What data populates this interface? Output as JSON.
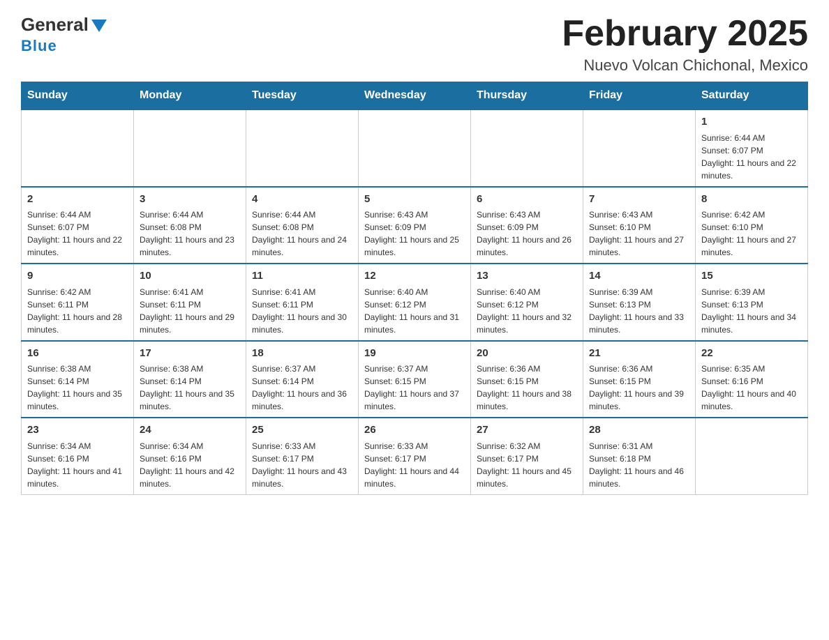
{
  "header": {
    "title": "February 2025",
    "subtitle": "Nuevo Volcan Chichonal, Mexico",
    "logo_general": "General",
    "logo_blue": "Blue"
  },
  "weekdays": [
    "Sunday",
    "Monday",
    "Tuesday",
    "Wednesday",
    "Thursday",
    "Friday",
    "Saturday"
  ],
  "weeks": [
    [
      {
        "day": "",
        "sunrise": "",
        "sunset": "",
        "daylight": ""
      },
      {
        "day": "",
        "sunrise": "",
        "sunset": "",
        "daylight": ""
      },
      {
        "day": "",
        "sunrise": "",
        "sunset": "",
        "daylight": ""
      },
      {
        "day": "",
        "sunrise": "",
        "sunset": "",
        "daylight": ""
      },
      {
        "day": "",
        "sunrise": "",
        "sunset": "",
        "daylight": ""
      },
      {
        "day": "",
        "sunrise": "",
        "sunset": "",
        "daylight": ""
      },
      {
        "day": "1",
        "sunrise": "Sunrise: 6:44 AM",
        "sunset": "Sunset: 6:07 PM",
        "daylight": "Daylight: 11 hours and 22 minutes."
      }
    ],
    [
      {
        "day": "2",
        "sunrise": "Sunrise: 6:44 AM",
        "sunset": "Sunset: 6:07 PM",
        "daylight": "Daylight: 11 hours and 22 minutes."
      },
      {
        "day": "3",
        "sunrise": "Sunrise: 6:44 AM",
        "sunset": "Sunset: 6:08 PM",
        "daylight": "Daylight: 11 hours and 23 minutes."
      },
      {
        "day": "4",
        "sunrise": "Sunrise: 6:44 AM",
        "sunset": "Sunset: 6:08 PM",
        "daylight": "Daylight: 11 hours and 24 minutes."
      },
      {
        "day": "5",
        "sunrise": "Sunrise: 6:43 AM",
        "sunset": "Sunset: 6:09 PM",
        "daylight": "Daylight: 11 hours and 25 minutes."
      },
      {
        "day": "6",
        "sunrise": "Sunrise: 6:43 AM",
        "sunset": "Sunset: 6:09 PM",
        "daylight": "Daylight: 11 hours and 26 minutes."
      },
      {
        "day": "7",
        "sunrise": "Sunrise: 6:43 AM",
        "sunset": "Sunset: 6:10 PM",
        "daylight": "Daylight: 11 hours and 27 minutes."
      },
      {
        "day": "8",
        "sunrise": "Sunrise: 6:42 AM",
        "sunset": "Sunset: 6:10 PM",
        "daylight": "Daylight: 11 hours and 27 minutes."
      }
    ],
    [
      {
        "day": "9",
        "sunrise": "Sunrise: 6:42 AM",
        "sunset": "Sunset: 6:11 PM",
        "daylight": "Daylight: 11 hours and 28 minutes."
      },
      {
        "day": "10",
        "sunrise": "Sunrise: 6:41 AM",
        "sunset": "Sunset: 6:11 PM",
        "daylight": "Daylight: 11 hours and 29 minutes."
      },
      {
        "day": "11",
        "sunrise": "Sunrise: 6:41 AM",
        "sunset": "Sunset: 6:11 PM",
        "daylight": "Daylight: 11 hours and 30 minutes."
      },
      {
        "day": "12",
        "sunrise": "Sunrise: 6:40 AM",
        "sunset": "Sunset: 6:12 PM",
        "daylight": "Daylight: 11 hours and 31 minutes."
      },
      {
        "day": "13",
        "sunrise": "Sunrise: 6:40 AM",
        "sunset": "Sunset: 6:12 PM",
        "daylight": "Daylight: 11 hours and 32 minutes."
      },
      {
        "day": "14",
        "sunrise": "Sunrise: 6:39 AM",
        "sunset": "Sunset: 6:13 PM",
        "daylight": "Daylight: 11 hours and 33 minutes."
      },
      {
        "day": "15",
        "sunrise": "Sunrise: 6:39 AM",
        "sunset": "Sunset: 6:13 PM",
        "daylight": "Daylight: 11 hours and 34 minutes."
      }
    ],
    [
      {
        "day": "16",
        "sunrise": "Sunrise: 6:38 AM",
        "sunset": "Sunset: 6:14 PM",
        "daylight": "Daylight: 11 hours and 35 minutes."
      },
      {
        "day": "17",
        "sunrise": "Sunrise: 6:38 AM",
        "sunset": "Sunset: 6:14 PM",
        "daylight": "Daylight: 11 hours and 35 minutes."
      },
      {
        "day": "18",
        "sunrise": "Sunrise: 6:37 AM",
        "sunset": "Sunset: 6:14 PM",
        "daylight": "Daylight: 11 hours and 36 minutes."
      },
      {
        "day": "19",
        "sunrise": "Sunrise: 6:37 AM",
        "sunset": "Sunset: 6:15 PM",
        "daylight": "Daylight: 11 hours and 37 minutes."
      },
      {
        "day": "20",
        "sunrise": "Sunrise: 6:36 AM",
        "sunset": "Sunset: 6:15 PM",
        "daylight": "Daylight: 11 hours and 38 minutes."
      },
      {
        "day": "21",
        "sunrise": "Sunrise: 6:36 AM",
        "sunset": "Sunset: 6:15 PM",
        "daylight": "Daylight: 11 hours and 39 minutes."
      },
      {
        "day": "22",
        "sunrise": "Sunrise: 6:35 AM",
        "sunset": "Sunset: 6:16 PM",
        "daylight": "Daylight: 11 hours and 40 minutes."
      }
    ],
    [
      {
        "day": "23",
        "sunrise": "Sunrise: 6:34 AM",
        "sunset": "Sunset: 6:16 PM",
        "daylight": "Daylight: 11 hours and 41 minutes."
      },
      {
        "day": "24",
        "sunrise": "Sunrise: 6:34 AM",
        "sunset": "Sunset: 6:16 PM",
        "daylight": "Daylight: 11 hours and 42 minutes."
      },
      {
        "day": "25",
        "sunrise": "Sunrise: 6:33 AM",
        "sunset": "Sunset: 6:17 PM",
        "daylight": "Daylight: 11 hours and 43 minutes."
      },
      {
        "day": "26",
        "sunrise": "Sunrise: 6:33 AM",
        "sunset": "Sunset: 6:17 PM",
        "daylight": "Daylight: 11 hours and 44 minutes."
      },
      {
        "day": "27",
        "sunrise": "Sunrise: 6:32 AM",
        "sunset": "Sunset: 6:17 PM",
        "daylight": "Daylight: 11 hours and 45 minutes."
      },
      {
        "day": "28",
        "sunrise": "Sunrise: 6:31 AM",
        "sunset": "Sunset: 6:18 PM",
        "daylight": "Daylight: 11 hours and 46 minutes."
      },
      {
        "day": "",
        "sunrise": "",
        "sunset": "",
        "daylight": ""
      }
    ]
  ]
}
